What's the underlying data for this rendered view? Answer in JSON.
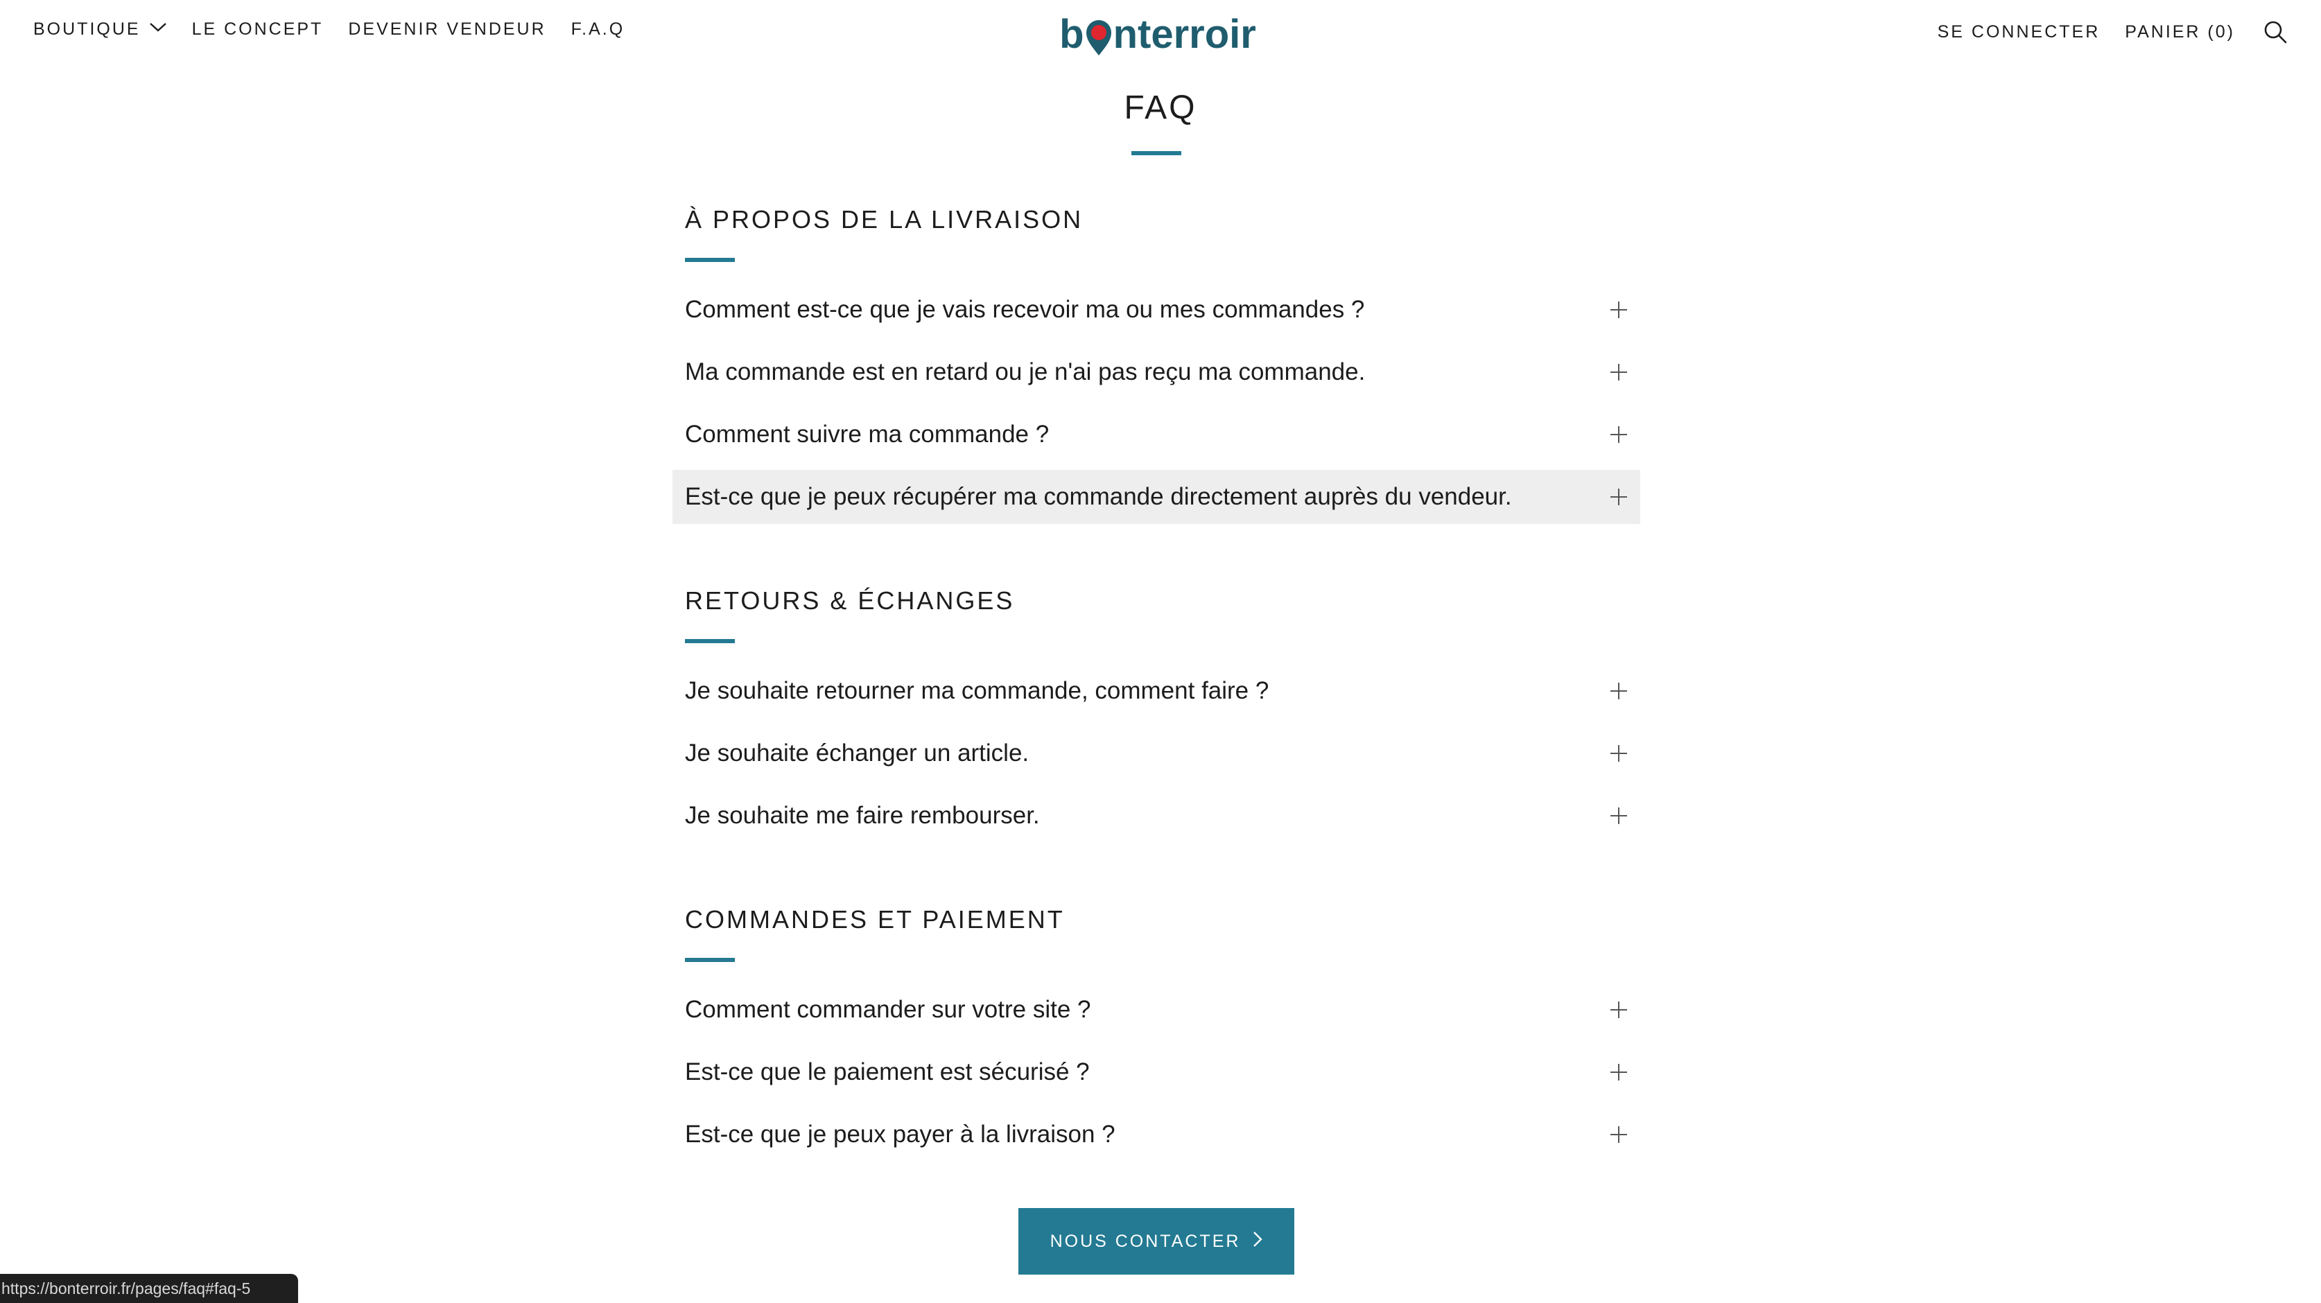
{
  "header": {
    "nav_left": [
      {
        "label": "BOUTIQUE",
        "has_dropdown": true
      },
      {
        "label": "LE CONCEPT"
      },
      {
        "label": "DEVENIR VENDEUR"
      },
      {
        "label": "F.A.Q"
      }
    ],
    "logo": {
      "text_before": "b",
      "text_after": "nterroir",
      "logo_color": "#1f5d6e",
      "pin_color": "#e0262e"
    },
    "nav_right": {
      "login": "SE CONNECTER",
      "cart": "PANIER (0)"
    }
  },
  "page": {
    "title": "FAQ"
  },
  "sections": [
    {
      "heading": "À PROPOS DE LA LIVRAISON",
      "questions": [
        "Comment est-ce que je vais recevoir ma ou mes commandes ?",
        "Ma commande est en retard ou je n'ai pas reçu ma commande.",
        "Comment suivre ma commande ?",
        "Est-ce que je peux récupérer ma commande directement auprès du vendeur."
      ]
    },
    {
      "heading": "RETOURS & ÉCHANGES",
      "questions": [
        "Je souhaite retourner ma commande, comment faire ?",
        "Je souhaite échanger un article.",
        "Je souhaite me faire rembourser."
      ]
    },
    {
      "heading": "COMMANDES ET PAIEMENT",
      "questions": [
        "Comment commander sur votre site ?",
        "Est-ce que le paiement est sécurisé ?",
        "Est-ce que je peux payer à la livraison ?"
      ]
    }
  ],
  "contact_button": {
    "label": "NOUS CONTACTER"
  },
  "status_bar": {
    "url": "https://bonterroir.fr/pages/faq#faq-5"
  },
  "colors": {
    "accent": "#237a92",
    "hover_row": "#eeeeee",
    "text": "#1c1c1c"
  },
  "icons": [
    "chevron-down-icon",
    "search-icon",
    "plus-icon",
    "chevron-right-icon",
    "map-pin-icon"
  ]
}
